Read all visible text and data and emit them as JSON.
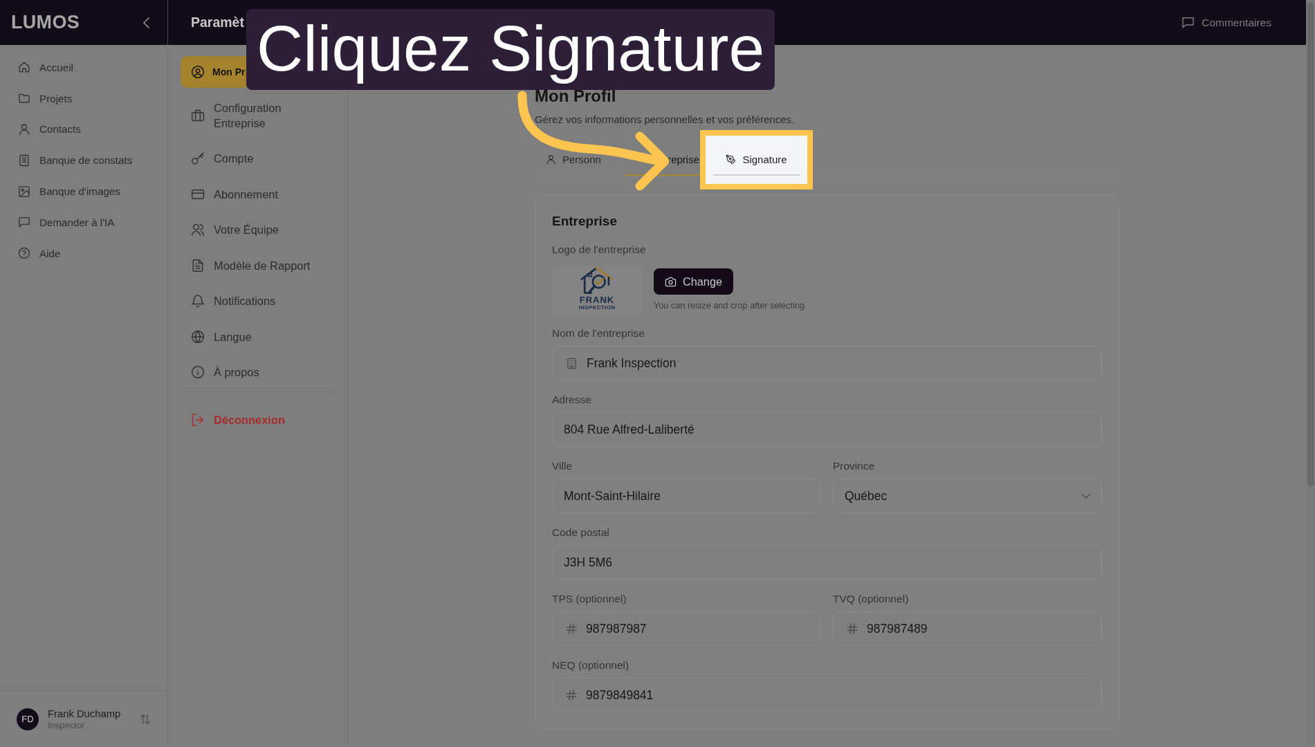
{
  "app": {
    "logo": "LUMOS",
    "section_title": "Paramèt",
    "feedback_button": "Commentaires"
  },
  "sidebar": {
    "items": [
      {
        "label": "Accueil",
        "selected": false
      },
      {
        "label": "Projets",
        "selected": false
      },
      {
        "label": "Contacts",
        "selected": false
      },
      {
        "label": "Banque de constats",
        "selected": false
      },
      {
        "label": "Banque d'images",
        "selected": false
      },
      {
        "label": "Demander à l'IA",
        "selected": false
      },
      {
        "label": "Aide",
        "selected": false
      }
    ],
    "user": {
      "initials": "FD",
      "name": "Frank Duchamp",
      "role": "Inspector"
    }
  },
  "settings_menu": {
    "items": [
      {
        "label": "Mon Pr",
        "selected": true
      },
      {
        "label": "Configuration Entreprise",
        "selected": false
      },
      {
        "label": "Compte",
        "selected": false
      },
      {
        "label": "Abonnement",
        "selected": false
      },
      {
        "label": "Votre Équipe",
        "selected": false
      },
      {
        "label": "Modèle de Rapport",
        "selected": false
      },
      {
        "label": "Notifications",
        "selected": false
      },
      {
        "label": "Langue",
        "selected": false
      },
      {
        "label": "À propos",
        "selected": false
      }
    ],
    "logout": "Déconnexion"
  },
  "page": {
    "title": "Mon Profil",
    "subtitle": "Gérez vos informations personnelles et vos préférences.",
    "tabs": [
      {
        "label": "Personn",
        "selected": false,
        "highlighted": false
      },
      {
        "label": "reprise",
        "selected": true,
        "highlighted": false
      },
      {
        "label": "Signature",
        "selected": false,
        "highlighted": true
      }
    ],
    "card": {
      "title": "Entreprise",
      "logo": {
        "label": "Logo de l'entreprise",
        "image_text": {
          "name": "FRANK",
          "tagline": "INSPECTION"
        },
        "button": "Change",
        "hint": "You can resize and crop after selecting"
      },
      "rows": [
        {
          "fields": [
            {
              "kind": "business",
              "label": "Nom de l'entreprise",
              "value": "Frank Inspection"
            }
          ]
        },
        {
          "fields": [
            {
              "kind": "text",
              "label": "Adresse",
              "value": "804 Rue Alfred-Laliberté"
            }
          ]
        },
        {
          "fields": [
            {
              "kind": "text",
              "label": "Ville",
              "value": "Mont-Saint-Hilaire"
            },
            {
              "kind": "select",
              "label": "Province",
              "value": "Québec"
            }
          ]
        },
        {
          "fields": [
            {
              "kind": "text",
              "label": "Code postal",
              "value": "J3H 5M6"
            }
          ]
        },
        {
          "fields": [
            {
              "kind": "number",
              "label": "TPS (optionnel)",
              "value": "987987987"
            },
            {
              "kind": "number",
              "label": "TVQ (optionnel)",
              "value": "987987489"
            }
          ]
        },
        {
          "fields": [
            {
              "kind": "number",
              "label": "NEQ (optionnel)",
              "value": "9879849841"
            }
          ]
        }
      ]
    }
  },
  "tutorial": {
    "caption": "Cliquez Signature"
  }
}
